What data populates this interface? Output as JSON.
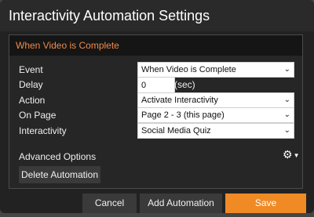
{
  "dialog": {
    "title": "Interactivity Automation Settings"
  },
  "panel": {
    "header": "When Video is Complete",
    "rows": [
      {
        "label": "Event",
        "value": "When Video is Complete"
      },
      {
        "label": "Delay",
        "value": "0",
        "unit": "(sec)"
      },
      {
        "label": "Action",
        "value": "Activate Interactivity"
      },
      {
        "label": "On Page",
        "value": "Page 2 - 3 (this page)"
      },
      {
        "label": "Interactivity",
        "value": "Social Media Quiz"
      }
    ],
    "advanced_options_label": "Advanced Options",
    "delete_button": "Delete Automation"
  },
  "footer": {
    "cancel": "Cancel",
    "add": "Add Automation",
    "save": "Save"
  },
  "colors": {
    "accent": "#f08a24",
    "header_text": "#f08a4b"
  },
  "icons": {
    "dropdown": "chevron-down-icon",
    "settings": "gear-icon"
  }
}
